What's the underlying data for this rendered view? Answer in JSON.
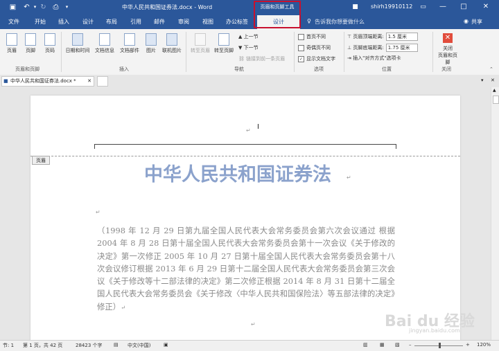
{
  "titlebar": {
    "document_title": "中华人民共和国证券法.docx - Word",
    "contextual_group": "页眉和页脚工具",
    "user": "shirh19910112",
    "window_buttons": [
      "—",
      "□",
      "✕"
    ]
  },
  "tabs": [
    "文件",
    "开始",
    "插入",
    "设计",
    "布局",
    "引用",
    "邮件",
    "审阅",
    "视图",
    "办公标签"
  ],
  "active_contextual_tab": "设计",
  "tell_me": "告诉我你想要做什么",
  "share": "共享",
  "ribbon": {
    "groups": {
      "header_footer": "页眉和页脚",
      "insert": "插入",
      "navigation": "导航",
      "options": "选项",
      "position": "位置",
      "close": "关闭"
    },
    "header_footer_buttons": [
      "页眉",
      "页脚",
      "页码"
    ],
    "insert_buttons": [
      "日期和时间",
      "文档信息",
      "文档部件",
      "图片",
      "联机图片"
    ],
    "nav_buttons": [
      "转至页眉",
      "转至页脚"
    ],
    "nav_items": [
      "上一节",
      "下一节",
      "链接到前一条页眉"
    ],
    "options": [
      {
        "label": "首页不同",
        "checked": false
      },
      {
        "label": "奇偶页不同",
        "checked": false
      },
      {
        "label": "显示文档文字",
        "checked": true
      }
    ],
    "position": {
      "header_distance_label": "页眉顶端距离:",
      "header_distance_value": "1.5 厘米",
      "footer_distance_label": "页脚底端距离:",
      "footer_distance_value": "1.75 厘米",
      "align_tab": "插入\"对齐方式\"选项卡"
    },
    "close_label_1": "关闭",
    "close_label_2": "页眉和页脚"
  },
  "document_tab": "中华人民共和国证券法.docx *",
  "page": {
    "header_badge": "页眉",
    "heading": "中华人民共和国证券法",
    "body": "（1998 年 12 月 29 日第九届全国人民代表大会常务委员会第六次会议通过 根据 2004 年 8 月 28 日第十届全国人民代表大会常务委员会第十一次会议《关于修改的决定》第一次修正 2005 年 10 月 27 日第十届全国人民代表大会常务委员会第十八次会议修订根据 2013 年 6 月 29 日第十二届全国人民代表大会常务委员会第三次会议《关于修改等十二部法律的决定》第二次修正根据 2014 年 8 月 31 日第十二届全国人民代表大会常务委员会《关于修改〈中华人民共和国保险法〉等五部法律的决定》修正）",
    "para_mark": "↵"
  },
  "statusbar": {
    "section": "节: 1",
    "page": "第 1 页，共 42 页",
    "words": "28423 个字",
    "language": "中文(中国)",
    "zoom": "120%"
  },
  "watermark": {
    "brand": "Bai du 经验",
    "url": "jingyan.baidu.com"
  }
}
